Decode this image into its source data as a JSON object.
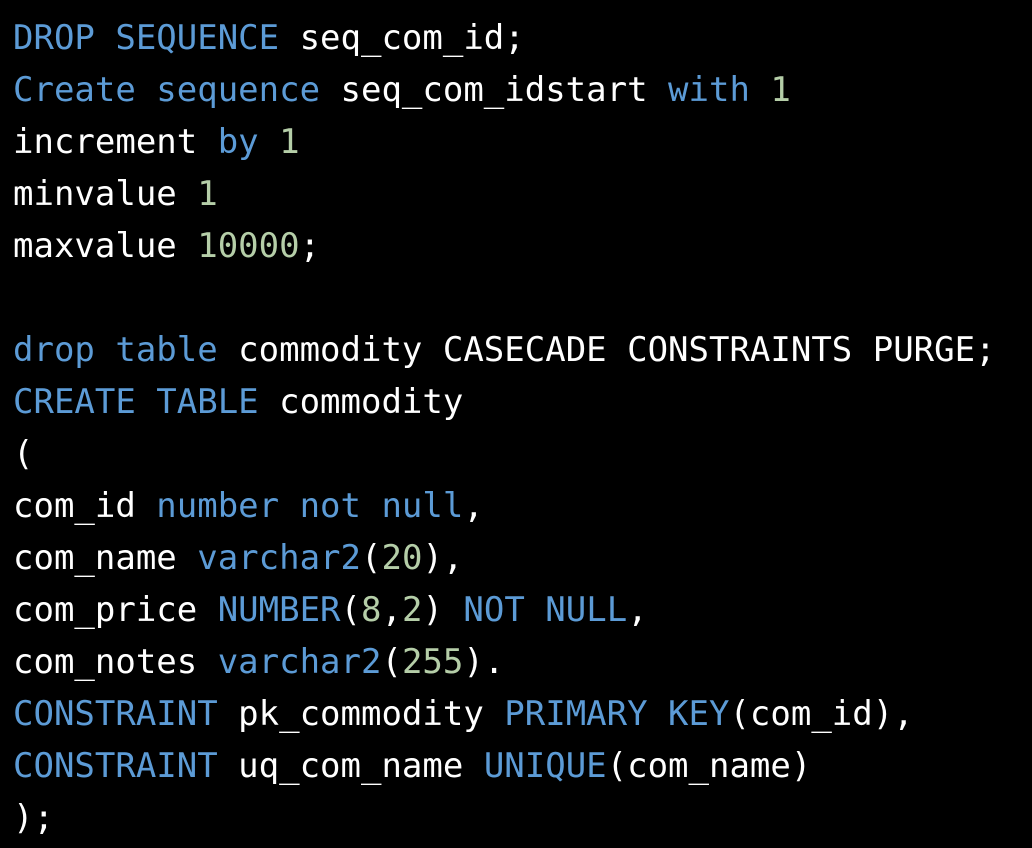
{
  "colors": {
    "background": "#000000",
    "plain": "#ffffff",
    "keyword": "#5c9bd6",
    "number": "#b5cea8"
  },
  "code_lines": [
    [
      {
        "t": "kw",
        "s": "DROP SEQUENCE"
      },
      {
        "t": "plain",
        "s": " seq_com_id;"
      }
    ],
    [
      {
        "t": "kw",
        "s": "Create sequence"
      },
      {
        "t": "plain",
        "s": " seq_com_idstart "
      },
      {
        "t": "kw",
        "s": "with"
      },
      {
        "t": "plain",
        "s": " "
      },
      {
        "t": "num",
        "s": "1"
      }
    ],
    [
      {
        "t": "plain",
        "s": "increment "
      },
      {
        "t": "kw",
        "s": "by"
      },
      {
        "t": "plain",
        "s": " "
      },
      {
        "t": "num",
        "s": "1"
      }
    ],
    [
      {
        "t": "plain",
        "s": "minvalue "
      },
      {
        "t": "num",
        "s": "1"
      }
    ],
    [
      {
        "t": "plain",
        "s": "maxvalue "
      },
      {
        "t": "num",
        "s": "10000"
      },
      {
        "t": "plain",
        "s": ";"
      }
    ],
    [],
    [
      {
        "t": "kw",
        "s": "drop table"
      },
      {
        "t": "plain",
        "s": " commodity CASECADE CONSTRAINTS PURGE;"
      }
    ],
    [
      {
        "t": "kw",
        "s": "CREATE TABLE"
      },
      {
        "t": "plain",
        "s": " commodity"
      }
    ],
    [
      {
        "t": "plain",
        "s": "("
      }
    ],
    [
      {
        "t": "plain",
        "s": "com_id "
      },
      {
        "t": "kw",
        "s": "number not null"
      },
      {
        "t": "plain",
        "s": ","
      }
    ],
    [
      {
        "t": "plain",
        "s": "com_name "
      },
      {
        "t": "kw",
        "s": "varchar2"
      },
      {
        "t": "plain",
        "s": "("
      },
      {
        "t": "num",
        "s": "20"
      },
      {
        "t": "plain",
        "s": "),"
      }
    ],
    [
      {
        "t": "plain",
        "s": "com_price "
      },
      {
        "t": "kw",
        "s": "NUMBER"
      },
      {
        "t": "plain",
        "s": "("
      },
      {
        "t": "num",
        "s": "8"
      },
      {
        "t": "plain",
        "s": ","
      },
      {
        "t": "num",
        "s": "2"
      },
      {
        "t": "plain",
        "s": ") "
      },
      {
        "t": "kw",
        "s": "NOT NULL"
      },
      {
        "t": "plain",
        "s": ","
      }
    ],
    [
      {
        "t": "plain",
        "s": "com_notes "
      },
      {
        "t": "kw",
        "s": "varchar2"
      },
      {
        "t": "plain",
        "s": "("
      },
      {
        "t": "num",
        "s": "255"
      },
      {
        "t": "plain",
        "s": ")."
      }
    ],
    [
      {
        "t": "kw",
        "s": "CONSTRAINT"
      },
      {
        "t": "plain",
        "s": " pk_commodity "
      },
      {
        "t": "kw",
        "s": "PRIMARY KEY"
      },
      {
        "t": "plain",
        "s": "(com_id),"
      }
    ],
    [
      {
        "t": "kw",
        "s": "CONSTRAINT"
      },
      {
        "t": "plain",
        "s": " uq_com_name "
      },
      {
        "t": "kw",
        "s": "UNIQUE"
      },
      {
        "t": "plain",
        "s": "(com_name)"
      }
    ],
    [
      {
        "t": "plain",
        "s": ");"
      }
    ]
  ]
}
